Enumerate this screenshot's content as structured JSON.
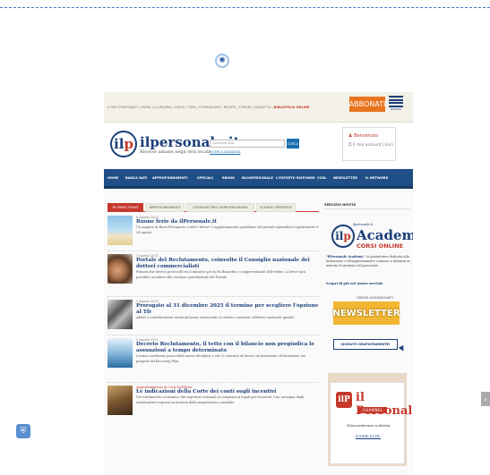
{
  "loader_icon": "wheel-icon",
  "toplinks": {
    "items": "IL MIO PERSONALE | GUIDA | LA PAGINA | CERCA | TEMI | FORMAZIONE | RIVISTE | FORUM | GAZZETTA | ",
    "highlight": "BIBLIOTECA ONLINE"
  },
  "abbonati": "ABBONATI",
  "gruppo": "MAGGIOLI",
  "logo": {
    "il": "il",
    "p": "p",
    "name": "ilpersonale.it",
    "tagline": "Risorse umane negli enti locali"
  },
  "search": {
    "placeholder": "Cerca nel sito",
    "button": "CERCA",
    "advanced": "RICERCA AVANZATA"
  },
  "account": {
    "welcome": "Benvenuto",
    "links": "Il mio account  |  Esci"
  },
  "nav": [
    "HOME",
    "BANCA DATI",
    "APPROFONDIMENTI",
    "SPECIALI",
    "EBOOK",
    "BLOGPERSONALE",
    "L'ESPERTO RISPONDE",
    "CCNL",
    "NEWSLETTER",
    "IL NETWORK"
  ],
  "tabs": [
    "IN PRIMO PIANO",
    "APPROFONDIMENTI",
    "OSSERVATORIO GIURISPRUDENZA",
    "SCHEDE OPERATIVE"
  ],
  "articles": [
    {
      "date": "6 Agosto 2021",
      "kicker": "",
      "title": "Buone ferie da ilPersonale.it",
      "summary": "Un augurio di Buon Ferragosto a tutti i lettori! L'aggiornamento quotidiano del portale riprenderà regolarmente il 24 agosto"
    },
    {
      "date": "5 Agosto 2021",
      "kicker": "",
      "title": "Portale del Reclutamento, coinvolto il Consiglio nazionale dei dottori commercialisti",
      "summary": "Firmati due diversi protocolli tra il ministro per la PA Brunetta e i rappresentanti dell'ordine. A breve sarà possibile accedere alla versione sperimentale del Portale"
    },
    {
      "date": "5 Agosto 2021",
      "kicker": "",
      "title": "Prorogato al 31 dicembre 2025 il termine per scegliere l'opzione al Tfr",
      "summary": "ARAN e confederazioni sindacali hanno sottoscritto il relativo contratto collettivo nazionale quadro"
    },
    {
      "date": "5 Agosto 2021",
      "kicker": "",
      "title": "Decreto Reclutamento, il tetto con il bilancio non pregiudica le assunzioni a tempo determinato",
      "summary": "L'unica condizione posta dalla nuova disciplina e che il contratto di lavoro sia funzionale all'attuazione dei progetti del Recovery Plan"
    },
    {
      "date": "",
      "kicker": "Approfondimento di Carlo Dell'Erba",
      "title": "Le indicazioni della Corte dei conti sugli incentivi",
      "summary": "Dal trattamento economico dei segretari comunali ai compensi ai legali per incarichi. Una rassegna degli orientamenti espressi in materia dalla magistratura contabile"
    }
  ],
  "side": {
    "heading": "SERVIZIO NOVITÀ",
    "academy": {
      "small": "ilpersonale.it",
      "big": "Academy",
      "corsi": "CORSI ONLINE",
      "desc_bold": "\"ilPersonale Academy\"",
      "desc": ": la piattaforma dedicata alla formazione e all'aggiornamento continuo a distanza in materia di gestione del personale",
      "link": "Scopri di più nel nuovo servizio"
    },
    "newsletter": {
      "firmati": "FIRMATI ASSUNZIONATO",
      "title": "NEWSLETTER",
      "button": "ISCRIVITI GRATUITAMENTE!"
    },
    "channel": {
      "logo": "ilP",
      "name": "il Personale",
      "channel": "CHANNEL",
      "desc": "Videoconferenze in diretta",
      "link": "SCOPRI DI PIÙ"
    }
  },
  "floating": {
    "shield_icon": "shield-icon",
    "scroll": "›"
  }
}
